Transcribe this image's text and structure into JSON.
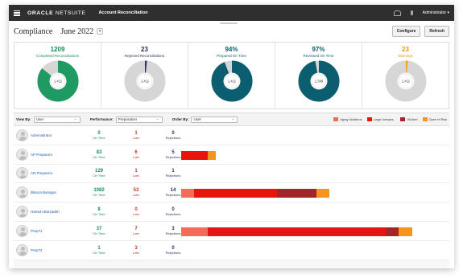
{
  "topbar": {
    "logo_main": "ORACLE",
    "logo_sub": "NETSUITE",
    "title": "Account Reconciliation",
    "user": "Administrator ▾"
  },
  "header": {
    "title": "Compliance",
    "month": "June 2022",
    "dropdown_glyph": "▾",
    "configure": "Configure",
    "refresh": "Refresh"
  },
  "kpis": [
    {
      "value": "1209",
      "label": "Completed Reconciliations",
      "center": "1,411",
      "fraction": 0.857,
      "color": "#1f9a63",
      "text_color": "#1a8a5a"
    },
    {
      "value": "23",
      "label": "Rejected Reconciliations",
      "center": "1,411",
      "fraction": 0.016,
      "color": "#3a2a6e",
      "text_color": "#1d2f4a"
    },
    {
      "value": "94%",
      "label": "Prepared On Time",
      "center": "1,411",
      "fraction": 0.94,
      "color": "#0b5d70",
      "text_color": "#0b5d70"
    },
    {
      "value": "97%",
      "label": "Reviewed On Time",
      "center": "1,349",
      "fraction": 0.97,
      "color": "#0b5d70",
      "text_color": "#0b5d70"
    },
    {
      "value": "23",
      "label": "Warnings",
      "center": "1,411",
      "fraction": 0.016,
      "color": "#f0a11e",
      "text_color": "#e39a12"
    }
  ],
  "filters": {
    "view_by_label": "View By:",
    "view_by_value": "User",
    "performance_label": "Performance:",
    "performance_value": "Preparation",
    "order_by_label": "Order By:",
    "order_by_value": "User"
  },
  "legend": [
    {
      "label": "Aging Violations",
      "color": "#f26b5b"
    },
    {
      "label": "Large Unexpla...",
      "color": "#e8140f"
    },
    {
      "label": "VA Alert",
      "color": "#a3252a"
    },
    {
      "label": "Open Hi Risk",
      "color": "#f5951e"
    }
  ],
  "stat_labels": {
    "ontime": "On Time",
    "late": "Late",
    "rejections": "Rejections"
  },
  "rows": [
    {
      "name": "Administrator",
      "ontime": "0",
      "late": "1",
      "rejections": "0",
      "bar": []
    },
    {
      "name": "AP Preparers",
      "ontime": "83",
      "late": "6",
      "rejections": "5",
      "bar": [
        {
          "c": "#e8140f",
          "w": 0.06
        },
        {
          "c": "#f5951e",
          "w": 0.02
        }
      ]
    },
    {
      "name": "AR Preparers",
      "ontime": "129",
      "late": "1",
      "rejections": "1",
      "bar": []
    },
    {
      "name": "Blanca Baragan",
      "ontime": "1082",
      "late": "53",
      "rejections": "14",
      "bar": [
        {
          "c": "#f26b5b",
          "w": 0.03
        },
        {
          "c": "#e8140f",
          "w": 0.19
        },
        {
          "c": "#a3252a",
          "w": 0.09
        },
        {
          "c": "#f5951e",
          "w": 0.03
        }
      ]
    },
    {
      "name": "Hamid Attarzadeh",
      "ontime": "8",
      "late": "0",
      "rejections": "0",
      "bar": []
    },
    {
      "name": "Prep71",
      "ontime": "37",
      "late": "7",
      "rejections": "3",
      "bar": [
        {
          "c": "#f26b5b",
          "w": 0.06
        },
        {
          "c": "#e8140f",
          "w": 0.41
        },
        {
          "c": "#a3252a",
          "w": 0.03
        },
        {
          "c": "#f5951e",
          "w": 0.03
        }
      ]
    },
    {
      "name": "Prep72",
      "ontime": "1",
      "late": "3",
      "rejections": "0",
      "bar": []
    }
  ]
}
